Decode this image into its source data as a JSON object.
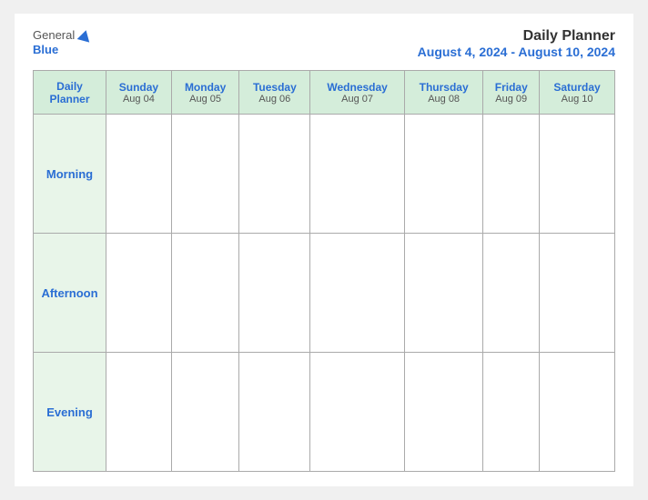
{
  "header": {
    "logo_general": "General",
    "logo_blue": "Blue",
    "title": "Daily Planner",
    "date_range": "August 4, 2024 - August 10, 2024"
  },
  "table": {
    "row_label_header": "Daily\nPlanner",
    "columns": [
      {
        "day": "Sunday",
        "date": "Aug 04"
      },
      {
        "day": "Monday",
        "date": "Aug 05"
      },
      {
        "day": "Tuesday",
        "date": "Aug 06"
      },
      {
        "day": "Wednesday",
        "date": "Aug 07"
      },
      {
        "day": "Thursday",
        "date": "Aug 08"
      },
      {
        "day": "Friday",
        "date": "Aug 09"
      },
      {
        "day": "Saturday",
        "date": "Aug 10"
      }
    ],
    "rows": [
      {
        "label": "Morning"
      },
      {
        "label": "Afternoon"
      },
      {
        "label": "Evening"
      }
    ]
  }
}
